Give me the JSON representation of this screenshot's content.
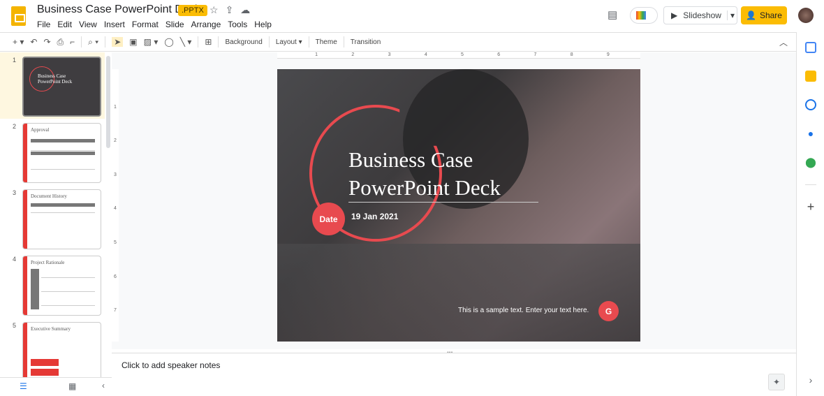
{
  "header": {
    "title": "Business Case  PowerPoint Deck",
    "badge": ".PPTX",
    "menu": [
      "File",
      "Edit",
      "View",
      "Insert",
      "Format",
      "Slide",
      "Arrange",
      "Tools",
      "Help"
    ],
    "slideshow_label": "Slideshow",
    "share_label": "Share"
  },
  "toolbar": {
    "background": "Background",
    "layout": "Layout ▾",
    "theme": "Theme",
    "transition": "Transition"
  },
  "thumbnails": [
    {
      "num": "1",
      "title": "Business Case PowerPoint Deck"
    },
    {
      "num": "2",
      "title": "Approval"
    },
    {
      "num": "3",
      "title": "Document History"
    },
    {
      "num": "4",
      "title": "Project Rationale"
    },
    {
      "num": "5",
      "title": "Executive Summary"
    }
  ],
  "ruler": {
    "top": [
      "1",
      "2",
      "3",
      "4",
      "5",
      "6",
      "7",
      "8",
      "9"
    ],
    "left": [
      "1",
      "2",
      "3",
      "4",
      "5",
      "6",
      "7"
    ]
  },
  "slide": {
    "title_line1": "Business Case",
    "title_line2": "PowerPoint Deck",
    "date_label": "Date",
    "date_value": "19 Jan 2021",
    "sample_text": "This is a sample text. Enter your text here.",
    "logo": "G",
    "accent": "#e84a4f"
  },
  "notes": {
    "placeholder": "Click to add speaker notes"
  }
}
